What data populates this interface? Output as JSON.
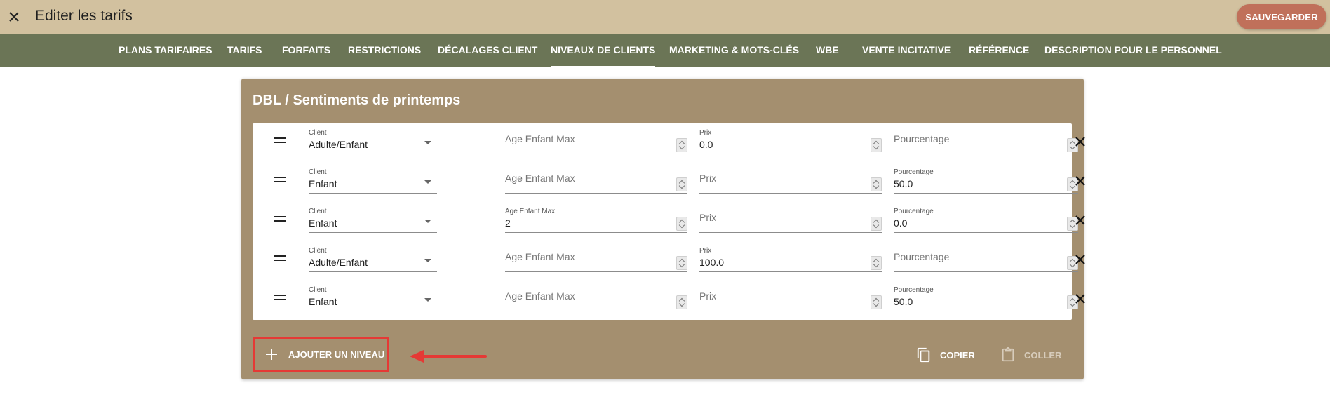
{
  "header": {
    "title": "Editer les tarifs",
    "save_label": "SAUVEGARDER",
    "close_icon": "close-icon"
  },
  "tabs": [
    {
      "label": "PLANS TARIFAIRES",
      "active": false
    },
    {
      "label": "TARIFS",
      "active": false
    },
    {
      "label": "FORFAITS",
      "active": false
    },
    {
      "label": "RESTRICTIONS",
      "active": false
    },
    {
      "label": "DÉCALAGES CLIENT",
      "active": false
    },
    {
      "label": "NIVEAUX DE CLIENTS",
      "active": true
    },
    {
      "label": "MARKETING & MOTS-CLÉS",
      "active": false
    },
    {
      "label": "WBE",
      "active": false
    },
    {
      "label": "VENTE INCITATIVE",
      "active": false
    },
    {
      "label": "RÉFÉRENCE",
      "active": false
    },
    {
      "label": "DESCRIPTION POUR LE PERSONNEL",
      "active": false
    }
  ],
  "card": {
    "title": "DBL / Sentiments de printemps",
    "field_labels": {
      "client": "Client",
      "age": "Age Enfant Max",
      "prix": "Prix",
      "pct": "Pourcentage"
    },
    "rows": [
      {
        "client": "Adulte/Enfant",
        "age": "",
        "prix": "0.0",
        "pct": ""
      },
      {
        "client": "Enfant",
        "age": "",
        "prix": "",
        "pct": "50.0"
      },
      {
        "client": "Enfant",
        "age": "2",
        "prix": "",
        "pct": "0.0"
      },
      {
        "client": "Adulte/Enfant",
        "age": "",
        "prix": "100.0",
        "pct": ""
      },
      {
        "client": "Enfant",
        "age": "",
        "prix": "",
        "pct": "50.0"
      }
    ],
    "add_label": "AJOUTER UN NIVEAU",
    "copy_label": "COPIER",
    "paste_label": "COLLER"
  },
  "colors": {
    "topbar": "#d2c19f",
    "navbar": "#6b7556",
    "card": "#a48f6f",
    "save": "#c0705a",
    "highlight": "#e53935"
  }
}
